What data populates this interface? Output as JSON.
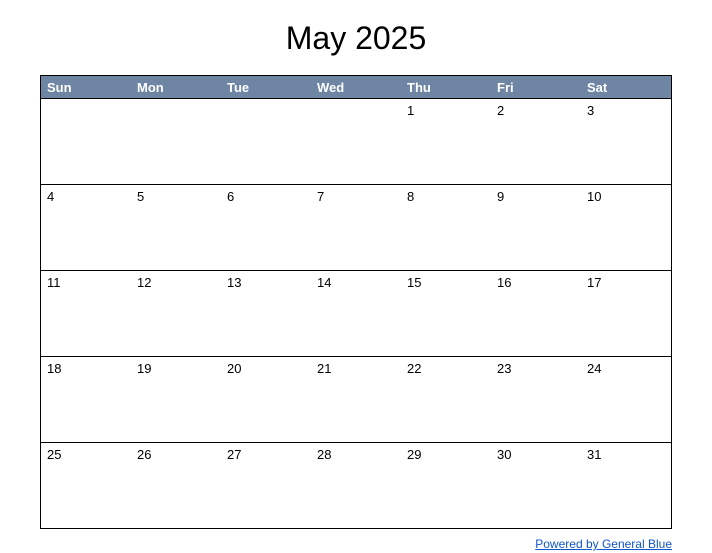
{
  "title": "May 2025",
  "weekdays": [
    "Sun",
    "Mon",
    "Tue",
    "Wed",
    "Thu",
    "Fri",
    "Sat"
  ],
  "weeks": [
    [
      "",
      "",
      "",
      "",
      "1",
      "2",
      "3"
    ],
    [
      "4",
      "5",
      "6",
      "7",
      "8",
      "9",
      "10"
    ],
    [
      "11",
      "12",
      "13",
      "14",
      "15",
      "16",
      "17"
    ],
    [
      "18",
      "19",
      "20",
      "21",
      "22",
      "23",
      "24"
    ],
    [
      "25",
      "26",
      "27",
      "28",
      "29",
      "30",
      "31"
    ]
  ],
  "footer": {
    "link_text": "Powered by General Blue"
  }
}
